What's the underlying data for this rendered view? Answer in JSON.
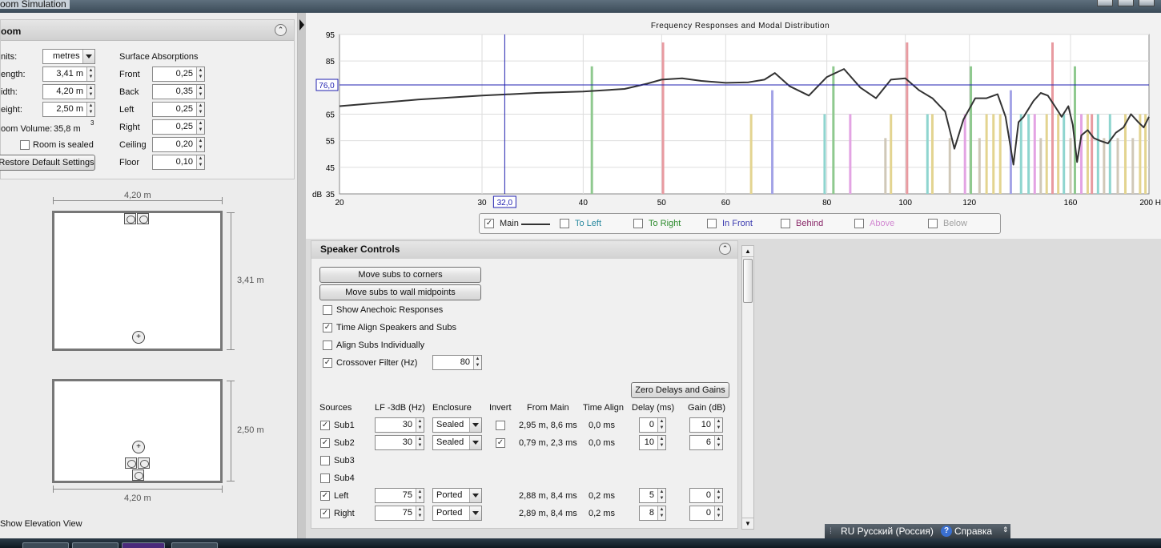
{
  "window": {
    "title": "oom Simulation"
  },
  "room": {
    "header": "oom",
    "units_label": "nits:",
    "units_value": "metres",
    "length_label": "ength:",
    "length_value": "3,41 m",
    "width_label": "idth:",
    "width_value": "4,20 m",
    "height_label": "eight:",
    "height_value": "2,50 m",
    "volume_label": "oom Volume:",
    "volume_value": "35,8 m",
    "volume_exp": "3",
    "sealed_label": "Room is sealed",
    "sealed_checked": false,
    "restore_label": "Restore Default Settings",
    "absorption_title": "Surface Absorptions",
    "absorptions": [
      {
        "label": "Front",
        "value": "0,25"
      },
      {
        "label": "Back",
        "value": "0,35"
      },
      {
        "label": "Left",
        "value": "0,25"
      },
      {
        "label": "Right",
        "value": "0,25"
      },
      {
        "label": "Ceiling",
        "value": "0,20"
      },
      {
        "label": "Floor",
        "value": "0,10"
      }
    ]
  },
  "plan": {
    "top_width": "4,20 m",
    "top_depth": "3,41 m",
    "side_height": "2,50 m",
    "side_width": "4,20 m",
    "elevation_label": "Show Elevation View"
  },
  "chart_data": {
    "type": "line",
    "title": "Frequency Responses and Modal Distribution",
    "ylabel": "dB",
    "y_ticks": [
      "95",
      "85",
      "76,0",
      "65",
      "55",
      "45",
      "35"
    ],
    "x_ticks": [
      "20",
      "30",
      "32,0",
      "40",
      "50",
      "60",
      "80",
      "100",
      "120",
      "160",
      "200 Hz"
    ],
    "xlim": [
      20,
      200
    ],
    "ylim": [
      35,
      95
    ],
    "x_scale": "log",
    "cursor_x": 32.0,
    "cursor_y": 76.0,
    "series": [
      {
        "name": "Main",
        "x": [
          20,
          25,
          30,
          35,
          40,
          45,
          48,
          50,
          53,
          56,
          60,
          64,
          67,
          69,
          72,
          76,
          80,
          84,
          88,
          92,
          96,
          100,
          104,
          108,
          112,
          115,
          118,
          122,
          126,
          130,
          133,
          136,
          138,
          140,
          144,
          147,
          150,
          153,
          156,
          159,
          161,
          163,
          165,
          168,
          171,
          174,
          178,
          182,
          186,
          190,
          194,
          197,
          200
        ],
        "y": [
          68,
          70.5,
          72,
          73,
          73.5,
          74.5,
          76.5,
          78,
          78.5,
          77.5,
          76.8,
          77,
          78,
          80.5,
          75.5,
          72,
          79,
          82,
          75,
          71,
          78,
          78.5,
          74,
          71,
          66,
          52,
          63,
          71,
          71,
          72.5,
          64,
          46,
          62,
          64,
          70,
          73,
          72,
          68,
          64,
          68,
          61,
          47,
          57,
          59,
          56,
          55,
          54,
          58,
          60,
          65,
          62,
          60,
          64
        ]
      }
    ],
    "modes": [
      {
        "f": 41,
        "type": "To Right",
        "h": 0.8,
        "color": "#8fc98f"
      },
      {
        "f": 50.2,
        "type": "To Left",
        "h": 0.95,
        "color": "#e89aa0"
      },
      {
        "f": 64.5,
        "type": "Behind",
        "h": 0.5,
        "color": "#e3d490"
      },
      {
        "f": 68.5,
        "type": "In Front",
        "h": 0.65,
        "color": "#a3a3e6"
      },
      {
        "f": 79.5,
        "type": "To Left",
        "h": 0.5,
        "color": "#8fd5cf"
      },
      {
        "f": 81.5,
        "type": "To Right",
        "h": 0.8,
        "color": "#8fc98f"
      },
      {
        "f": 85.5,
        "type": "Above",
        "h": 0.5,
        "color": "#e3a3e3"
      },
      {
        "f": 94.5,
        "type": "Below",
        "h": 0.35,
        "color": "#d0c8b8"
      },
      {
        "f": 96,
        "type": "Behind",
        "h": 0.5,
        "color": "#e3d490"
      },
      {
        "f": 100.5,
        "type": "To Left",
        "h": 0.95,
        "color": "#e89aa0"
      },
      {
        "f": 106.5,
        "type": "To Left",
        "h": 0.5,
        "color": "#8fd5cf"
      },
      {
        "f": 108,
        "type": "Behind",
        "h": 0.5,
        "color": "#e3d490"
      },
      {
        "f": 113.5,
        "type": "Below",
        "h": 0.35,
        "color": "#d0c8b8"
      },
      {
        "f": 118.5,
        "type": "Above",
        "h": 0.5,
        "color": "#e3a3e3"
      },
      {
        "f": 120.5,
        "type": "To Right",
        "h": 0.8,
        "color": "#8fc98f"
      },
      {
        "f": 123.5,
        "type": "Below",
        "h": 0.35,
        "color": "#d0c8b8"
      },
      {
        "f": 126,
        "type": "Behind",
        "h": 0.5,
        "color": "#e3d490"
      },
      {
        "f": 128.5,
        "type": "Behind",
        "h": 0.5,
        "color": "#e3d490"
      },
      {
        "f": 131,
        "type": "Behind",
        "h": 0.5,
        "color": "#e3d490"
      },
      {
        "f": 135,
        "type": "In Front",
        "h": 0.65,
        "color": "#a3a3e6"
      },
      {
        "f": 139,
        "type": "To Left",
        "h": 0.5,
        "color": "#8fd5cf"
      },
      {
        "f": 142,
        "type": "To Left",
        "h": 0.5,
        "color": "#8fd5cf"
      },
      {
        "f": 144.5,
        "type": "Above",
        "h": 0.5,
        "color": "#e3a3e3"
      },
      {
        "f": 147,
        "type": "Below",
        "h": 0.35,
        "color": "#d0c8b8"
      },
      {
        "f": 149.5,
        "type": "Behind",
        "h": 0.5,
        "color": "#e3d490"
      },
      {
        "f": 152,
        "type": "To Left",
        "h": 0.95,
        "color": "#e89aa0"
      },
      {
        "f": 154.5,
        "type": "Behind",
        "h": 0.5,
        "color": "#e3d490"
      },
      {
        "f": 157,
        "type": "To Left",
        "h": 0.5,
        "color": "#8fd5cf"
      },
      {
        "f": 160,
        "type": "Below",
        "h": 0.35,
        "color": "#d0c8b8"
      },
      {
        "f": 162,
        "type": "To Right",
        "h": 0.8,
        "color": "#8fc98f"
      },
      {
        "f": 165,
        "type": "Above",
        "h": 0.5,
        "color": "#e3a3e3"
      },
      {
        "f": 168,
        "type": "Behind",
        "h": 0.5,
        "color": "#e3d490"
      },
      {
        "f": 170,
        "type": "To Left",
        "h": 0.5,
        "color": "#e89aa0"
      },
      {
        "f": 173,
        "type": "To Left",
        "h": 0.5,
        "color": "#8fd5cf"
      },
      {
        "f": 176,
        "type": "Below",
        "h": 0.35,
        "color": "#d0c8b8"
      },
      {
        "f": 179,
        "type": "To Left",
        "h": 0.5,
        "color": "#8fd5cf"
      },
      {
        "f": 183,
        "type": "Below",
        "h": 0.35,
        "color": "#d0c8b8"
      },
      {
        "f": 187,
        "type": "Behind",
        "h": 0.5,
        "color": "#e3d490"
      },
      {
        "f": 191,
        "type": "Below",
        "h": 0.35,
        "color": "#d0c8b8"
      },
      {
        "f": 195,
        "type": "Behind",
        "h": 0.5,
        "color": "#e3d490"
      },
      {
        "f": 198,
        "type": "Behind",
        "h": 0.5,
        "color": "#e3d490"
      }
    ],
    "legend": [
      {
        "label": "Main",
        "checked": true,
        "color": "#222222"
      },
      {
        "label": "To Left",
        "checked": false,
        "color": "#2a8aa0"
      },
      {
        "label": "To Right",
        "checked": false,
        "color": "#2a8a2a"
      },
      {
        "label": "In Front",
        "checked": false,
        "color": "#3a3ab0"
      },
      {
        "label": "Behind",
        "checked": false,
        "color": "#8a2a6a"
      },
      {
        "label": "Above",
        "checked": false,
        "color": "#d28ad2"
      },
      {
        "label": "Below",
        "checked": false,
        "color": "#a0a0a0"
      }
    ]
  },
  "speaker_controls": {
    "header": "Speaker Controls",
    "move_corners": "Move subs to corners",
    "move_midpoints": "Move subs to wall midpoints",
    "options": [
      {
        "label": "Show Anechoic Responses",
        "checked": false
      },
      {
        "label": "Time Align Speakers and Subs",
        "checked": true
      },
      {
        "label": "Align Subs Individually",
        "checked": false
      },
      {
        "label": "Crossover Filter (Hz)",
        "checked": true
      }
    ],
    "crossover_value": "80",
    "zero_button": "Zero Delays and Gains",
    "columns": [
      "Sources",
      "LF -3dB (Hz)",
      "Enclosure",
      "Invert",
      "From Main",
      "Time Align",
      "Delay (ms)",
      "Gain (dB)"
    ],
    "rows": [
      {
        "name": "Sub1",
        "checked": true,
        "lf": "30",
        "enc": "Sealed",
        "invert": false,
        "from_main": "2,95 m, 8,6 ms",
        "time_align": "0,0 ms",
        "delay": "0",
        "gain": "10"
      },
      {
        "name": "Sub2",
        "checked": true,
        "lf": "30",
        "enc": "Sealed",
        "invert": true,
        "from_main": "0,79 m, 2,3 ms",
        "time_align": "0,0 ms",
        "delay": "10",
        "gain": "6"
      },
      {
        "name": "Sub3",
        "checked": false
      },
      {
        "name": "Sub4",
        "checked": false
      },
      {
        "name": "Left",
        "checked": true,
        "lf": "75",
        "enc": "Ported",
        "from_main": "2,88 m, 8,4 ms",
        "time_align": "0,2 ms",
        "delay": "5",
        "gain": "0"
      },
      {
        "name": "Right",
        "checked": true,
        "lf": "75",
        "enc": "Ported",
        "from_main": "2,89 m, 8,4 ms",
        "time_align": "0,2 ms",
        "delay": "8",
        "gain": "0"
      }
    ]
  },
  "langbar": {
    "lang": "RU Русский (Россия)",
    "help": "Справка"
  }
}
